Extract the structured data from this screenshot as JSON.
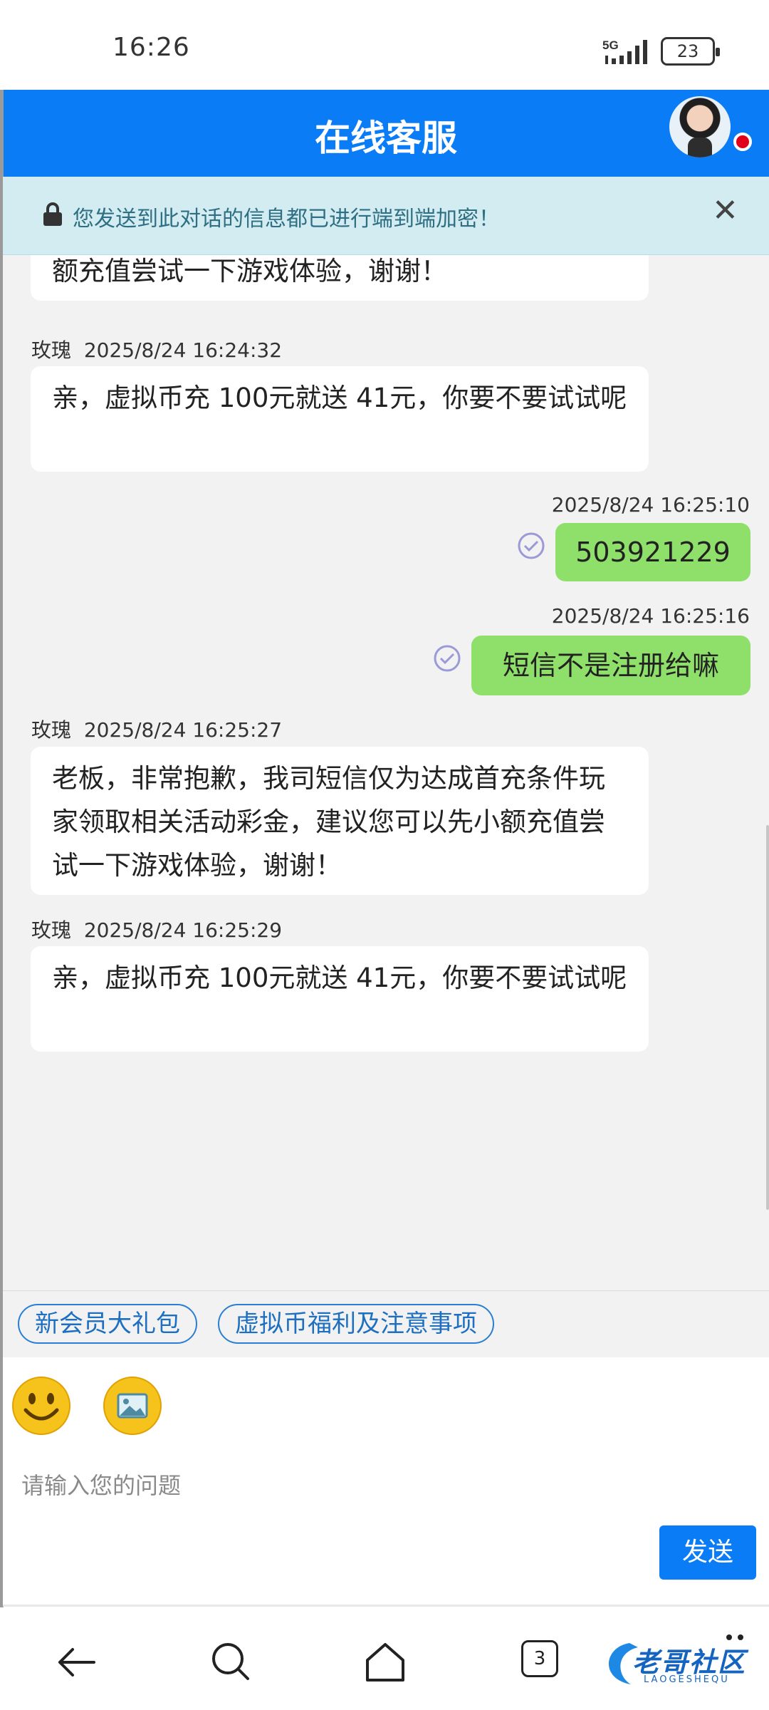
{
  "status_bar": {
    "time": "16:26",
    "network": "5G",
    "battery": "23"
  },
  "header": {
    "title": "在线客服"
  },
  "banner": {
    "text": "您发送到此对话的信息都已进行端到端加密！"
  },
  "messages": [
    {
      "side": "left",
      "text": "额充值尝试一下游戏体验，谢谢！"
    },
    {
      "side": "left",
      "sender": "玫瑰",
      "time": "2025/8/24 16:24:32",
      "text": "亲，虚拟币充 100元就送 41元，你要不要试试呢"
    },
    {
      "side": "right",
      "time": "2025/8/24 16:25:10",
      "text": "503921229"
    },
    {
      "side": "right",
      "time": "2025/8/24 16:25:16",
      "text": "短信不是注册给嘛"
    },
    {
      "side": "left",
      "sender": "玫瑰",
      "time": "2025/8/24 16:25:27",
      "text": "老板，非常抱歉，我司短信仅为达成首充条件玩家领取相关活动彩金，建议您可以先小额充值尝试一下游戏体验，谢谢！"
    },
    {
      "side": "left",
      "sender": "玫瑰",
      "time": "2025/8/24 16:25:29",
      "text": "亲，虚拟币充 100元就送 41元，你要不要试试呢"
    }
  ],
  "quick_replies": [
    "新会员大礼包",
    "虚拟币福利及注意事项"
  ],
  "input": {
    "placeholder": "请输入您的问题",
    "value": ""
  },
  "send_button": "发送",
  "nav": {
    "tabs_count": "3"
  },
  "watermark": {
    "text": "老哥社区",
    "sub": "LAOGESHEQU"
  },
  "colors": {
    "header_blue": "#0a7cf6",
    "bubble_green": "#8fe06a",
    "banner_bg": "#d3ecf1",
    "chat_bg": "#f2f2f2"
  }
}
